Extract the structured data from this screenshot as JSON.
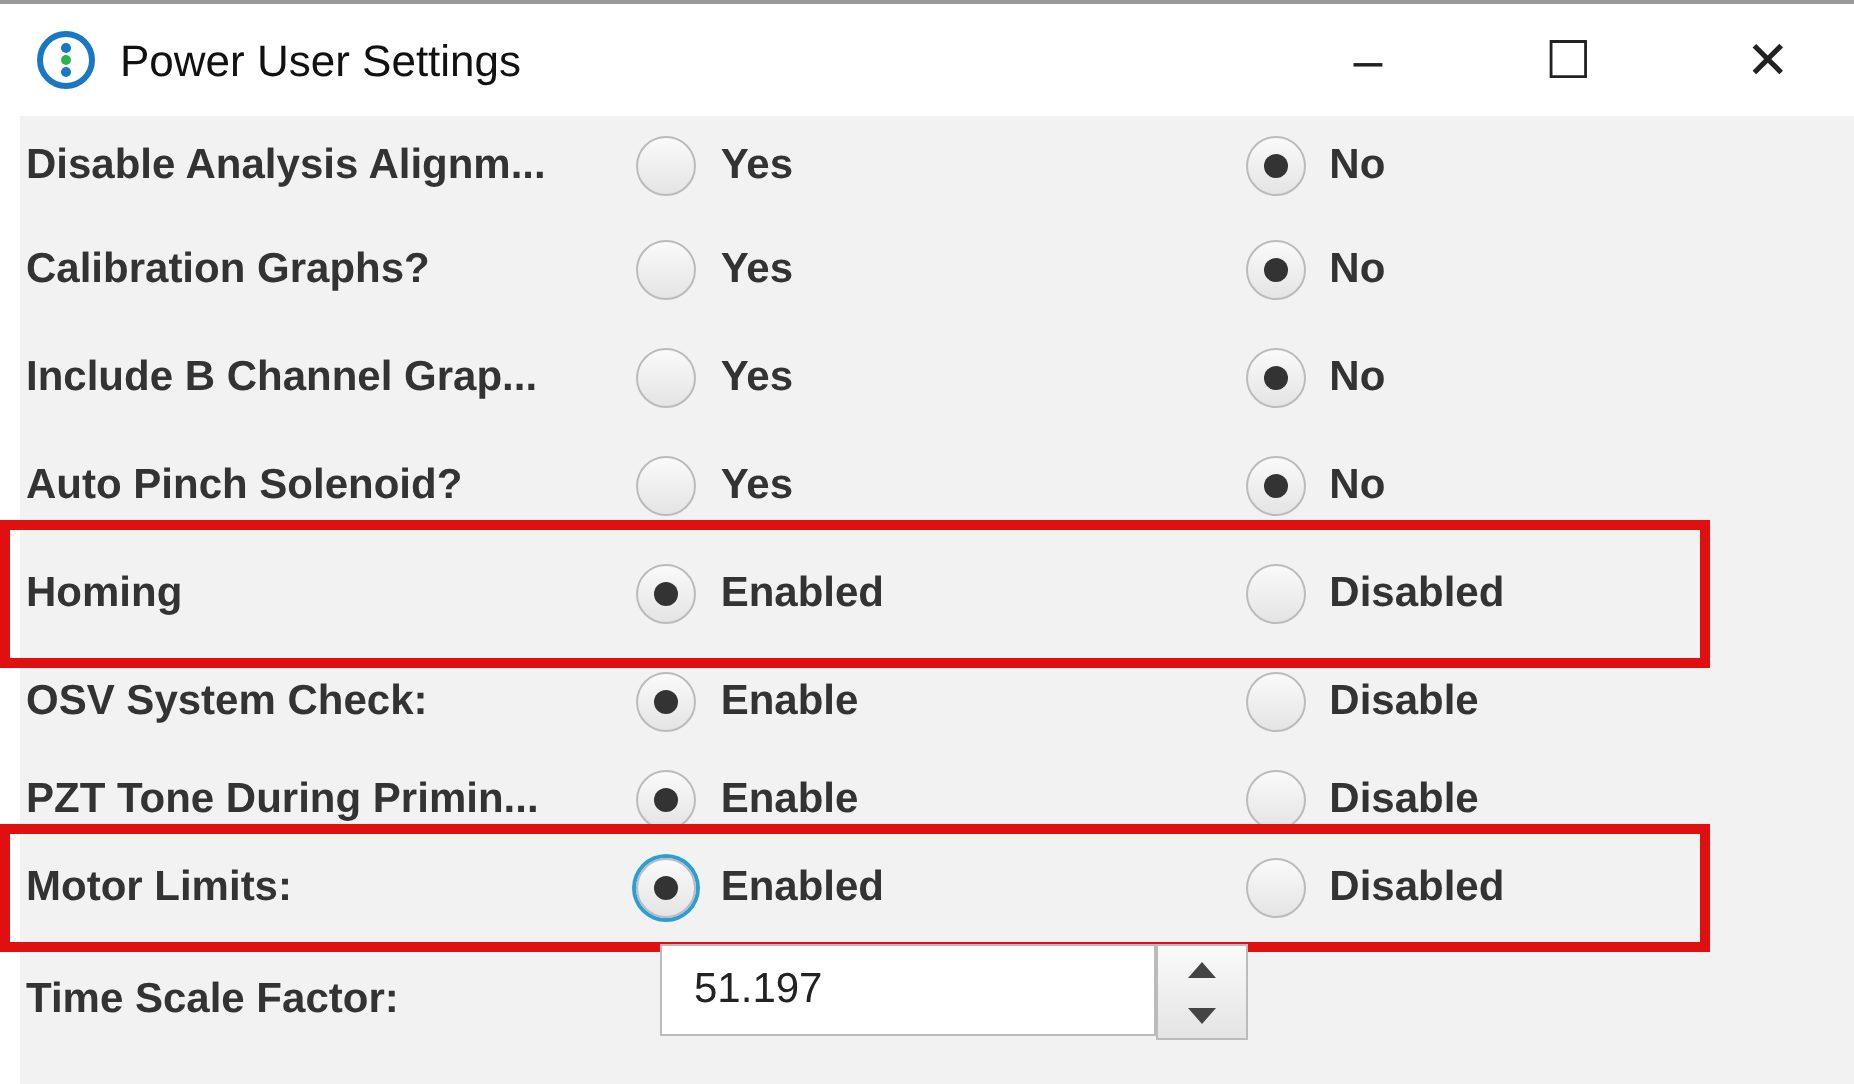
{
  "window": {
    "title": "Power User Settings",
    "controls": [
      "–",
      "☐",
      "✕"
    ]
  },
  "settings": [
    {
      "label": "Disable Analysis Alignm...",
      "highlighted": false,
      "options": [
        {
          "text": "Yes",
          "selected": false,
          "focused": false
        },
        {
          "text": "No",
          "selected": true,
          "focused": false
        }
      ]
    },
    {
      "label": "Calibration Graphs?",
      "highlighted": false,
      "options": [
        {
          "text": "Yes",
          "selected": false,
          "focused": false
        },
        {
          "text": "No",
          "selected": true,
          "focused": false
        }
      ]
    },
    {
      "label": "Include B Channel Grap...",
      "highlighted": false,
      "options": [
        {
          "text": "Yes",
          "selected": false,
          "focused": false
        },
        {
          "text": "No",
          "selected": true,
          "focused": false
        }
      ]
    },
    {
      "label": "Auto Pinch Solenoid?",
      "highlighted": false,
      "options": [
        {
          "text": "Yes",
          "selected": false,
          "focused": false
        },
        {
          "text": "No",
          "selected": true,
          "focused": false
        }
      ]
    },
    {
      "label": "Homing",
      "highlighted": true,
      "options": [
        {
          "text": "Enabled",
          "selected": true,
          "focused": false
        },
        {
          "text": "Disabled",
          "selected": false,
          "focused": false
        }
      ]
    },
    {
      "label": "OSV System Check:",
      "highlighted": false,
      "options": [
        {
          "text": "Enable",
          "selected": true,
          "focused": false
        },
        {
          "text": "Disable",
          "selected": false,
          "focused": false
        }
      ]
    },
    {
      "label": "PZT Tone During Primin...",
      "highlighted": false,
      "options": [
        {
          "text": "Enable",
          "selected": true,
          "focused": false
        },
        {
          "text": "Disable",
          "selected": false,
          "focused": false
        }
      ]
    },
    {
      "label": "Motor Limits:",
      "highlighted": true,
      "options": [
        {
          "text": "Enabled",
          "selected": true,
          "focused": true
        },
        {
          "text": "Disabled",
          "selected": false,
          "focused": false
        }
      ]
    }
  ],
  "time_scale": {
    "label": "Time Scale Factor:",
    "value": "51.197"
  }
}
